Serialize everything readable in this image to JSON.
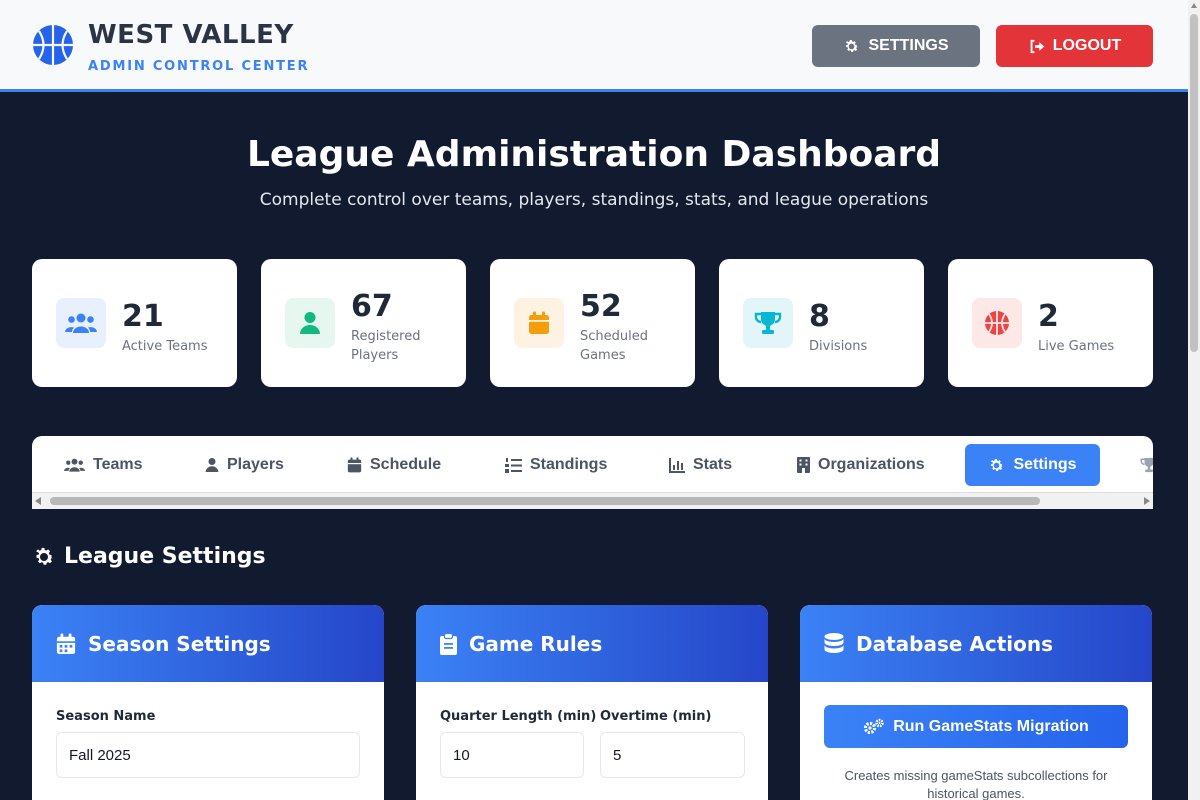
{
  "header": {
    "brand_title": "WEST VALLEY",
    "brand_subtitle": "ADMIN CONTROL CENTER",
    "settings_label": "SETTINGS",
    "logout_label": "LOGOUT"
  },
  "hero": {
    "title": "League Administration Dashboard",
    "subtitle": "Complete control over teams, players, standings, stats, and league operations"
  },
  "stats": [
    {
      "value": "21",
      "label": "Active Teams",
      "icon": "users-icon",
      "color": "#3b82f6"
    },
    {
      "value": "67",
      "label": "Registered Players",
      "icon": "user-icon",
      "color": "#10b981"
    },
    {
      "value": "52",
      "label": "Scheduled Games",
      "icon": "calendar-icon",
      "color": "#f59e0b"
    },
    {
      "value": "8",
      "label": "Divisions",
      "icon": "trophy-icon",
      "color": "#06b6d4"
    },
    {
      "value": "2",
      "label": "Live Games",
      "icon": "basketball-icon",
      "color": "#ef4444"
    }
  ],
  "tabs": [
    {
      "label": "Teams"
    },
    {
      "label": "Players"
    },
    {
      "label": "Schedule"
    },
    {
      "label": "Standings"
    },
    {
      "label": "Stats"
    },
    {
      "label": "Organizations"
    },
    {
      "label": "Settings",
      "active": true
    }
  ],
  "section": {
    "title": "League Settings"
  },
  "season_panel": {
    "title": "Season Settings",
    "season_name_label": "Season Name",
    "season_name_value": "Fall 2025"
  },
  "rules_panel": {
    "title": "Game Rules",
    "quarter_label": "Quarter Length (min)",
    "quarter_value": "10",
    "overtime_label": "Overtime (min)",
    "overtime_value": "5"
  },
  "db_panel": {
    "title": "Database Actions",
    "migrate_label": "Run GameStats Migration",
    "migrate_note": "Creates missing gameStats subcollections for historical games."
  },
  "colors": {
    "accent": "#3b82f6",
    "logout": "#e3343a",
    "background": "#111a2e"
  }
}
